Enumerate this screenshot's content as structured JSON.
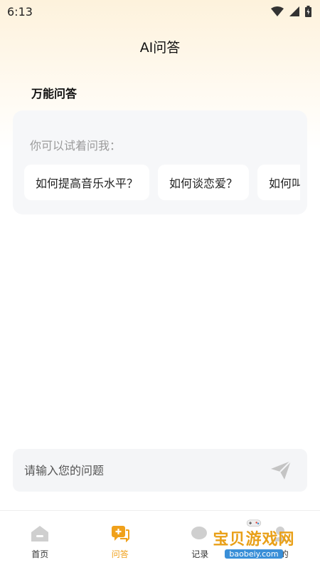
{
  "status_bar": {
    "time": "6:13"
  },
  "header": {
    "title": "AI问答"
  },
  "section": {
    "title": "万能问答"
  },
  "suggestions": {
    "hint": "你可以试着问我：",
    "chips": [
      "如何提高音乐水平？",
      "如何谈恋爱？",
      "如何叫"
    ]
  },
  "input": {
    "placeholder": "请输入您的问题"
  },
  "tabbar": {
    "items": [
      {
        "label": "首页",
        "icon": "home-icon"
      },
      {
        "label": "问答",
        "icon": "qa-chat-icon",
        "active": true
      },
      {
        "label": "记录",
        "icon": "record-icon"
      },
      {
        "label": "我的",
        "icon": "profile-icon"
      }
    ]
  },
  "watermark": {
    "title": "宝贝游戏网",
    "subtitle": "baobeiy.com"
  },
  "colors": {
    "accent": "#f0a11b",
    "card_bg": "#f6f7f9",
    "icon_gray": "#cfcfcf"
  }
}
